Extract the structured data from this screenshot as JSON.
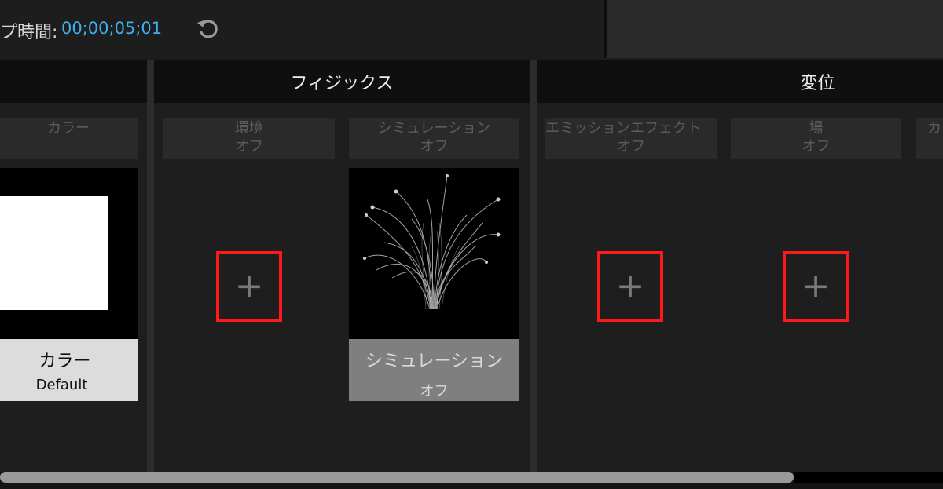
{
  "header": {
    "duration_label": "プ時間:",
    "duration_value": "00;00;05;01",
    "reset_icon": "undo-icon"
  },
  "columns": {
    "physics_title": "フィジックス",
    "transform_title": "変位"
  },
  "slots": {
    "color_label": "カラー",
    "environment_label": "環境",
    "environment_state": "オフ",
    "simulation_label": "シミュレーション",
    "simulation_state": "オフ",
    "emitter_label": "エミッションエフェクト",
    "emitter_state": "オフ",
    "field_label": "場",
    "field_state": "オフ",
    "cutoff_label": "カ"
  },
  "cards": {
    "color_title": "カラー",
    "color_sub": "Default",
    "simulation_title": "シミュレーション",
    "simulation_sub": "オフ"
  },
  "add_buttons": [
    "+",
    "+",
    "+"
  ],
  "colors": {
    "accent": "#3fb0ea",
    "highlight_box": "#ff1a1a",
    "panel": "#1e1e1e",
    "header": "#0f0f0f"
  }
}
